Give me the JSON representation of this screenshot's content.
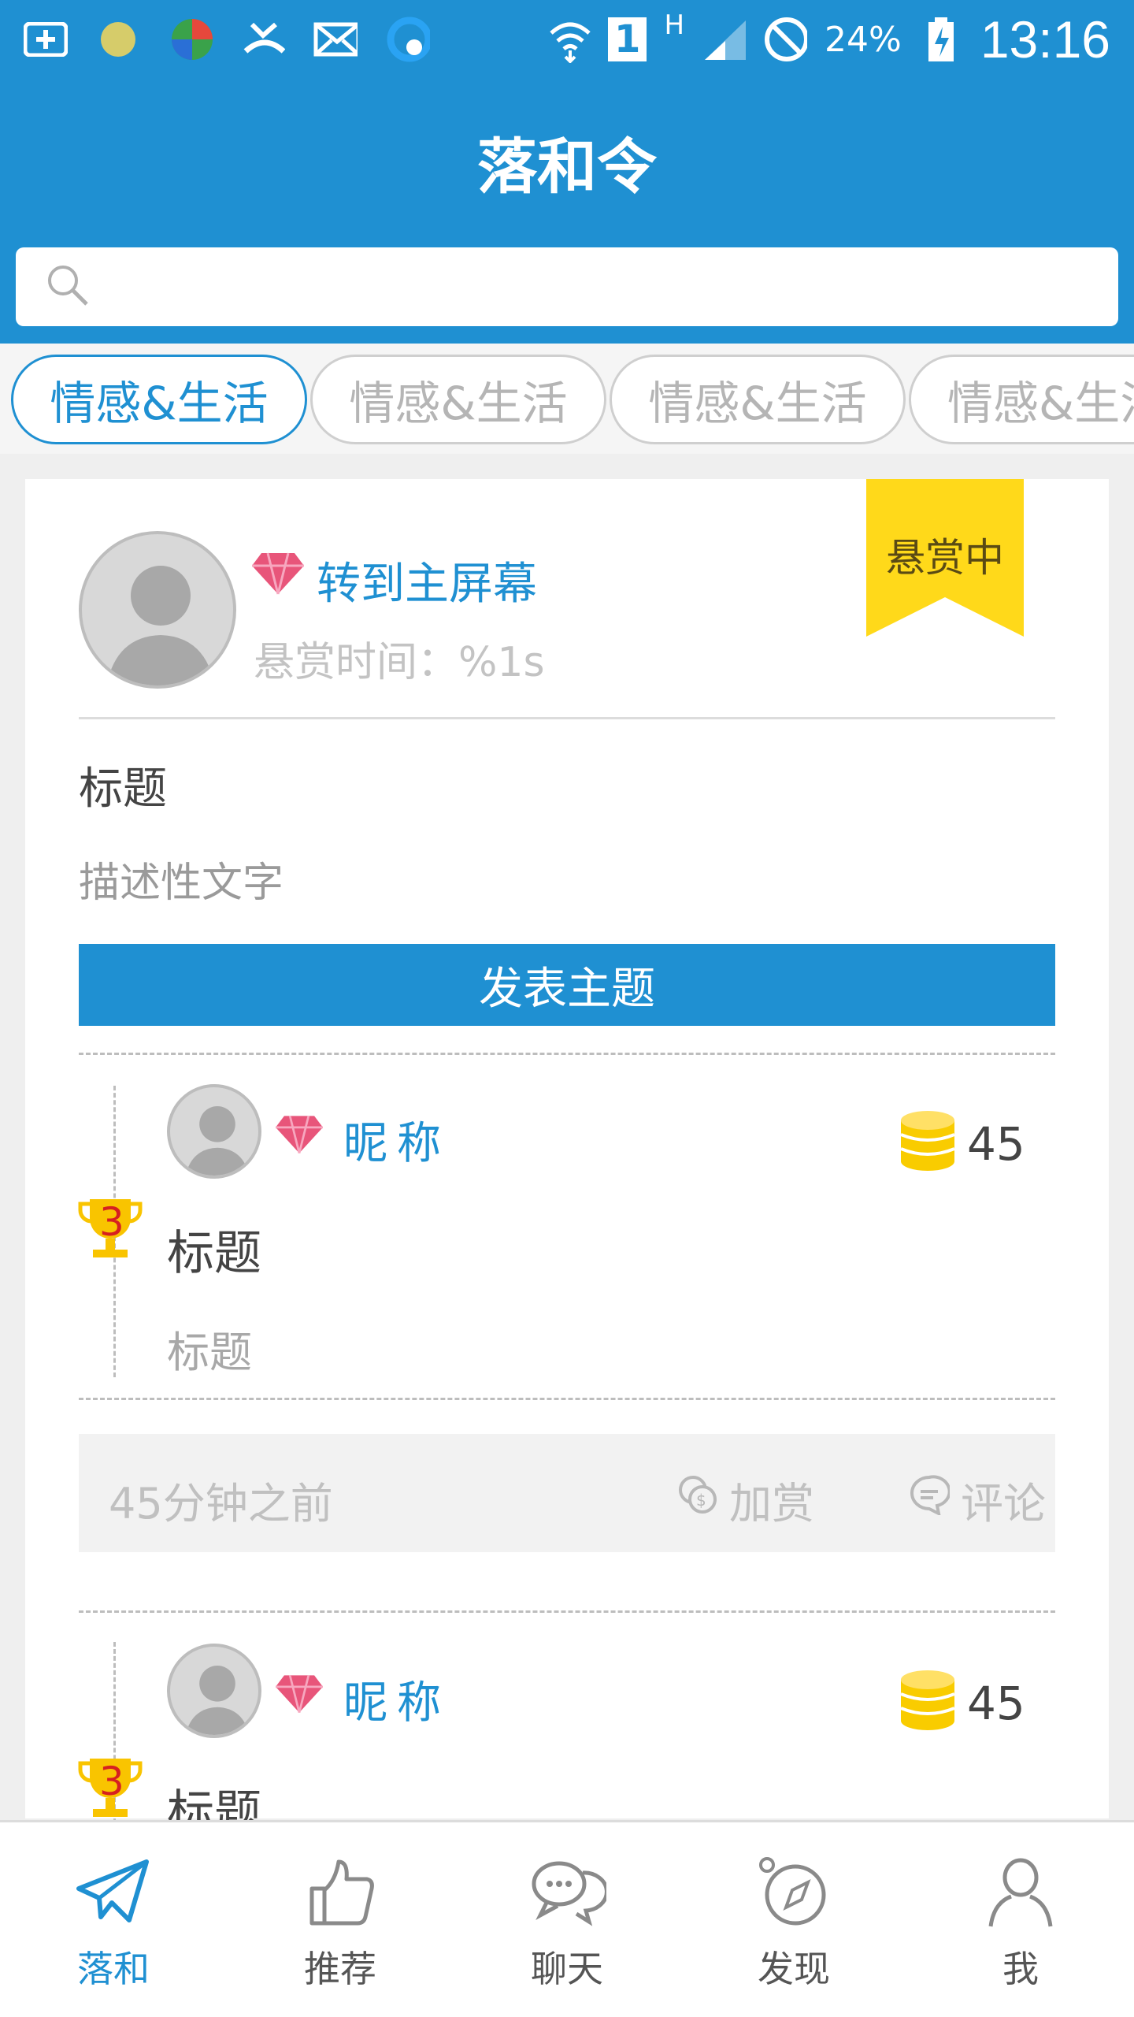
{
  "status_bar": {
    "battery": "24%",
    "time": "13:16",
    "sim": "1",
    "network": "H"
  },
  "header": {
    "title": "落和令"
  },
  "search": {
    "placeholder": ""
  },
  "tabs": [
    {
      "label": "情感&生活",
      "active": true
    },
    {
      "label": "情感&生活",
      "active": false
    },
    {
      "label": "情感&生活",
      "active": false
    },
    {
      "label": "情感&生活",
      "active": false
    }
  ],
  "post": {
    "ribbon": "悬赏中",
    "name": "转到主屏幕",
    "reward_time": "悬赏时间：%1s",
    "title": "标题",
    "description": "描述性文字",
    "publish_button": "发表主题"
  },
  "replies": [
    {
      "rank": "3",
      "nickname": "昵称",
      "coins": "45",
      "title": "标题",
      "subtitle": "标题"
    },
    {
      "rank": "3",
      "nickname": "昵称",
      "coins": "45",
      "title": "标题",
      "subtitle": ""
    }
  ],
  "actions": {
    "time_ago": "45分钟之前",
    "add_reward": "加赏",
    "comment": "评论"
  },
  "nav": [
    {
      "label": "落和",
      "icon": "paper-plane-icon",
      "active": true
    },
    {
      "label": "推荐",
      "icon": "thumbs-up-icon",
      "active": false
    },
    {
      "label": "聊天",
      "icon": "chat-bubbles-icon",
      "active": false
    },
    {
      "label": "发现",
      "icon": "compass-icon",
      "active": false
    },
    {
      "label": "我",
      "icon": "person-icon",
      "active": false
    }
  ],
  "colors": {
    "primary": "#1f90d2",
    "ribbon": "#ffd91a",
    "gem": "#e8557a",
    "coin": "#f9cc00"
  }
}
